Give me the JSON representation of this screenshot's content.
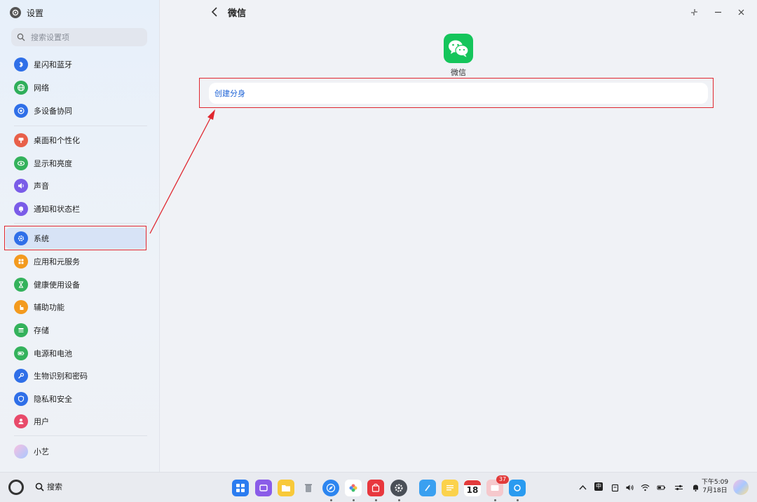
{
  "window": {
    "app_title": "设置",
    "page_title": "微信"
  },
  "search": {
    "placeholder": "搜索设置项"
  },
  "sidebar": {
    "items": [
      {
        "label": "星闪和蓝牙",
        "icon": "bluetooth-icon",
        "color": "#2f6fe8"
      },
      {
        "label": "网络",
        "icon": "globe-icon",
        "color": "#2fae5a"
      },
      {
        "label": "多设备协同",
        "icon": "devices-icon",
        "color": "#2f6fe8"
      },
      {
        "label": "桌面和个性化",
        "icon": "palette-icon",
        "color": "#e8604a"
      },
      {
        "label": "显示和亮度",
        "icon": "eye-icon",
        "color": "#34b25c"
      },
      {
        "label": "声音",
        "icon": "speaker-icon",
        "color": "#7a5ce8"
      },
      {
        "label": "通知和状态栏",
        "icon": "bell-icon",
        "color": "#7a5ce8"
      },
      {
        "label": "系统",
        "icon": "gear-icon",
        "color": "#2f6fe8"
      },
      {
        "label": "应用和元服务",
        "icon": "apps-icon",
        "color": "#f39a1e"
      },
      {
        "label": "健康使用设备",
        "icon": "hourglass-icon",
        "color": "#34b25c"
      },
      {
        "label": "辅助功能",
        "icon": "hand-icon",
        "color": "#f39a1e"
      },
      {
        "label": "存储",
        "icon": "storage-icon",
        "color": "#34b25c"
      },
      {
        "label": "电源和电池",
        "icon": "battery-icon",
        "color": "#34b25c"
      },
      {
        "label": "生物识别和密码",
        "icon": "key-icon",
        "color": "#2f6fe8"
      },
      {
        "label": "隐私和安全",
        "icon": "shield-icon",
        "color": "#2f6fe8"
      },
      {
        "label": "用户",
        "icon": "user-icon",
        "color": "#e84a6a"
      },
      {
        "label": "小艺",
        "icon": "assistant-icon",
        "color": "#c9a7f0"
      }
    ]
  },
  "main": {
    "app_name": "微信",
    "clone_label": "创建分身"
  },
  "taskbar": {
    "search_label": "搜索",
    "calendar_day": "18",
    "notification_badge": "37",
    "clock_time": "下午5:09",
    "clock_date": "7月18日",
    "ime_label": "中"
  },
  "colors": {
    "accent": "#1e63d6",
    "highlight_frame": "#e0272f",
    "wechat_green": "#15c55b"
  }
}
